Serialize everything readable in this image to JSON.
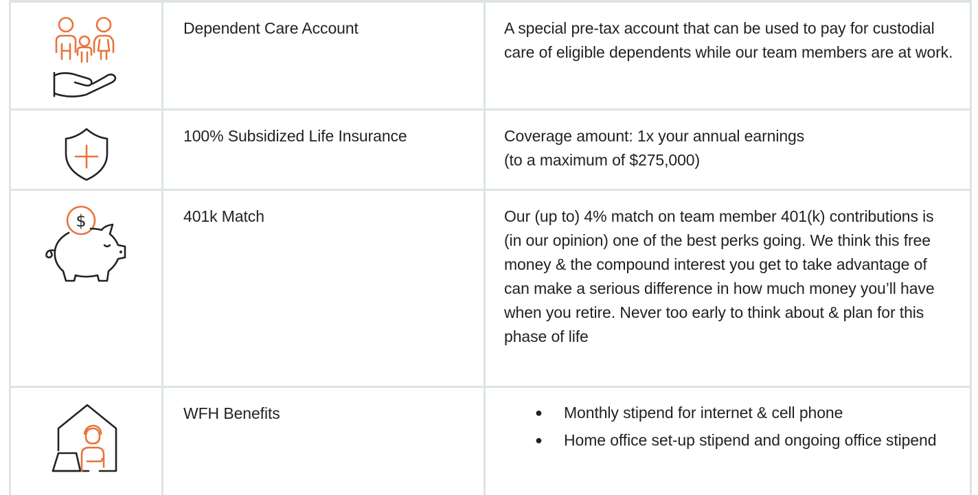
{
  "colors": {
    "accent": "#e8733a",
    "line": "#222222",
    "grid": "#dde4e6"
  },
  "rows": [
    {
      "icon": "family-care-hand-icon",
      "name": "Dependent Care Account",
      "description": "A special pre-tax account that can be used to pay for custodial care of eligible dependents while our team members are at work."
    },
    {
      "icon": "shield-plus-icon",
      "name": "100% Subsidized Life Insurance",
      "description_lines": [
        "Coverage amount: 1x your annual earnings",
        "(to a maximum of $275,000)"
      ]
    },
    {
      "icon": "piggy-bank-dollar-icon",
      "name": "401k Match",
      "description": "Our (up to) 4% match on team member 401(k) contributions is (in our opinion) one of the best perks going. We think this free money & the compound interest you get to take advantage of can make a serious difference in how much money you’ll have when you retire. Never too early to think about & plan for this phase of life"
    },
    {
      "icon": "home-office-laptop-icon",
      "name": "WFH Benefits",
      "bullets": [
        "Monthly stipend for internet & cell phone",
        "Home office set-up stipend and ongoing office stipend"
      ],
      "bullet_char": "●"
    }
  ]
}
